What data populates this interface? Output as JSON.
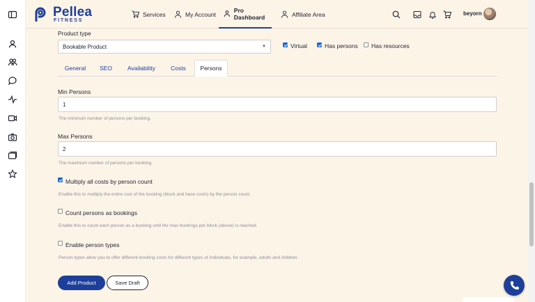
{
  "brand": {
    "name": "Pellea",
    "sub": "FITNESS",
    "color": "#1d3f9a"
  },
  "nav": [
    {
      "label": "Services",
      "icon": "cart-icon"
    },
    {
      "label": "My Account",
      "icon": "user-icon"
    },
    {
      "label": "Pro Dashboard",
      "icon": "user-icon",
      "active": true
    },
    {
      "label": "Affiliate Area",
      "icon": "user-icon"
    }
  ],
  "user": {
    "name": "beyorn"
  },
  "sidebar_icons": [
    "panel-toggle-icon",
    "user-network-icon",
    "users-icon",
    "chat-icon",
    "activity-icon",
    "video-icon",
    "camera-icon",
    "cards-icon",
    "star-icon"
  ],
  "form": {
    "product_type_label": "Product type",
    "product_type_value": "Bookable Product",
    "virtual_label": "Virtual",
    "virtual_checked": true,
    "has_persons_label": "Has persons",
    "has_persons_checked": true,
    "has_resources_label": "Has resources",
    "has_resources_checked": false,
    "tabs": [
      "General",
      "SEO",
      "Availability",
      "Costs",
      "Persons"
    ],
    "active_tab": "Persons",
    "min_persons_label": "Min Persons",
    "min_persons_value": "1",
    "min_persons_help": "The minimum number of persons per booking.",
    "max_persons_label": "Max Persons",
    "max_persons_value": "2",
    "max_persons_help": "The maximum number of persons per booking.",
    "multiply_label": "Multiply all costs by person count",
    "multiply_checked": true,
    "multiply_help": "Enable this to multiply the entire cost of the booking (block and base costs) by the person count.",
    "count_label": "Count persons as bookings",
    "count_checked": false,
    "count_help": "Enable this to count each person as a booking until the max bookings per block (above) is reached.",
    "types_label": "Enable person types",
    "types_checked": false,
    "types_help": "Person types allow you to offer different booking costs for different types of individuals, for example, adults and children."
  },
  "buttons": {
    "add_product": "Add Product",
    "save_draft": "Save Draft"
  },
  "colors": {
    "background": "#fdf4e8",
    "accent": "#1d3f9a",
    "checkbox": "#1d67d4"
  }
}
